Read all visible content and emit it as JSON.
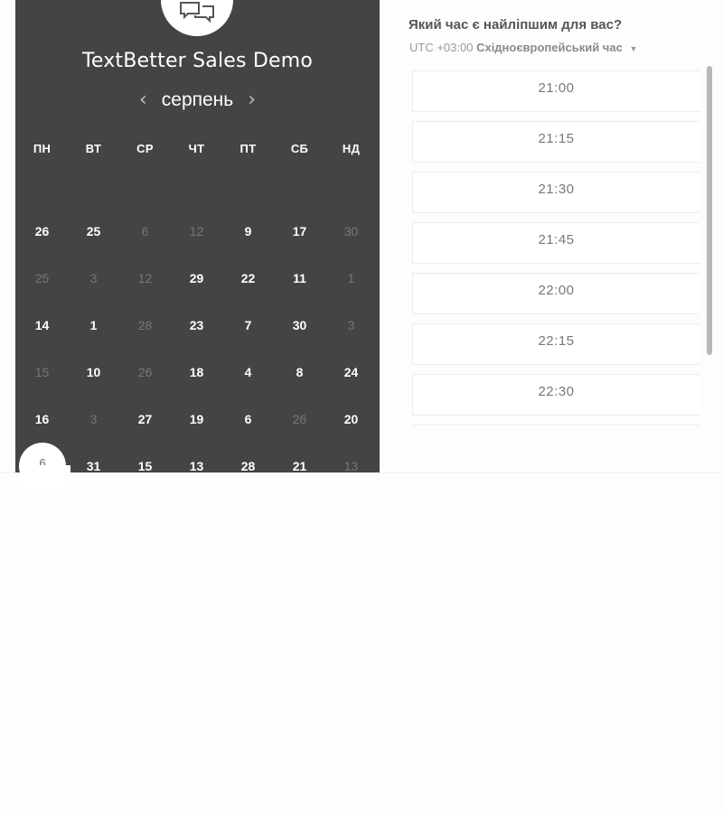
{
  "event": {
    "title": "TextBetter Sales Demo",
    "logo_icon": "chat-bubbles-icon"
  },
  "calendar": {
    "month": "серпень",
    "prev_icon": "chevron-left-icon",
    "next_icon": "chevron-right-icon",
    "weekdays": [
      "ПН",
      "ВТ",
      "СР",
      "ЧТ",
      "ПТ",
      "СБ",
      "НД"
    ],
    "weeks": [
      [
        {
          "d": "26",
          "available": true
        },
        {
          "d": "25",
          "available": true
        },
        {
          "d": "6",
          "available": false
        },
        {
          "d": "12",
          "available": false
        },
        {
          "d": "9",
          "available": true
        },
        {
          "d": "17",
          "available": true
        },
        {
          "d": "30",
          "available": false
        }
      ],
      [
        {
          "d": "25",
          "available": false
        },
        {
          "d": "3",
          "available": false
        },
        {
          "d": "12",
          "available": false
        },
        {
          "d": "29",
          "available": true
        },
        {
          "d": "22",
          "available": true
        },
        {
          "d": "11",
          "available": true
        },
        {
          "d": "1",
          "available": false
        }
      ],
      [
        {
          "d": "14",
          "available": true
        },
        {
          "d": "1",
          "available": true
        },
        {
          "d": "28",
          "available": false
        },
        {
          "d": "23",
          "available": true
        },
        {
          "d": "7",
          "available": true
        },
        {
          "d": "30",
          "available": true
        },
        {
          "d": "3",
          "available": false
        }
      ],
      [
        {
          "d": "15",
          "available": false
        },
        {
          "d": "10",
          "available": true
        },
        {
          "d": "26",
          "available": false
        },
        {
          "d": "18",
          "available": true
        },
        {
          "d": "4",
          "available": true
        },
        {
          "d": "8",
          "available": true
        },
        {
          "d": "24",
          "available": true
        }
      ],
      [
        {
          "d": "16",
          "available": true
        },
        {
          "d": "3",
          "available": false
        },
        {
          "d": "27",
          "available": true
        },
        {
          "d": "19",
          "available": true
        },
        {
          "d": "6",
          "available": true
        },
        {
          "d": "26",
          "available": false
        },
        {
          "d": "20",
          "available": true
        }
      ],
      [
        {
          "d": "6",
          "available": true,
          "selected": true
        },
        {
          "d": "31",
          "available": true
        },
        {
          "d": "15",
          "available": true
        },
        {
          "d": "13",
          "available": true
        },
        {
          "d": "28",
          "available": true
        },
        {
          "d": "21",
          "available": true
        },
        {
          "d": "13",
          "available": false
        }
      ]
    ]
  },
  "times": {
    "question": "Який час є найліпшим для вас?",
    "timezone_offset": "UTC +03:00",
    "timezone_name": "Східноєвропейський час",
    "timezone_caret": "caret-down-icon",
    "slots": [
      "21:00",
      "21:15",
      "21:30",
      "21:45",
      "22:00",
      "22:15",
      "22:30"
    ]
  },
  "colors": {
    "panel_bg": "#444444",
    "accent": "#ffffff",
    "muted_day": "#777777"
  }
}
